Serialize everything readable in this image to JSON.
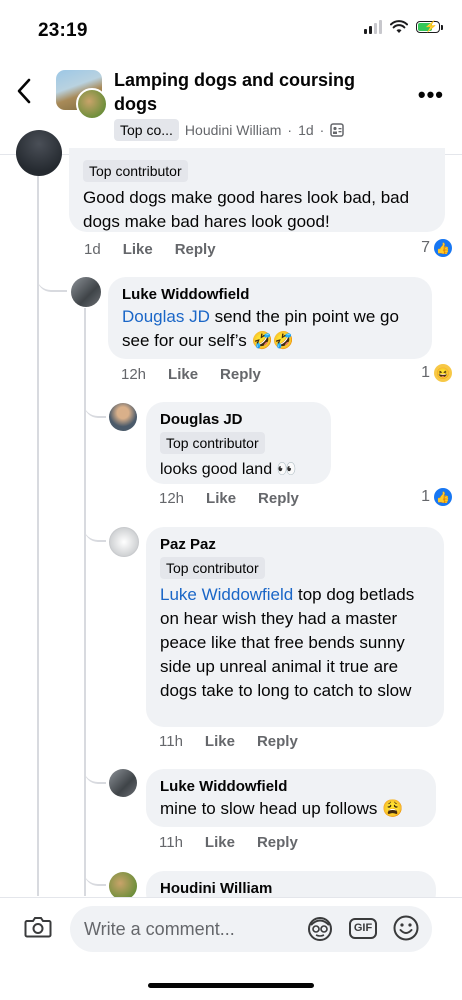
{
  "status_bar": {
    "time": "23:19",
    "battery_level": 0.7
  },
  "header": {
    "group_name": "Lamping dogs and coursing dogs",
    "badge": "Top co...",
    "author": "Houdini William",
    "age": "1d",
    "icons": [
      "back-chevron-icon",
      "more-options-icon",
      "group-privacy-icon"
    ]
  },
  "comments": [
    {
      "badge": "Top contributor",
      "text": "Good dogs make good hares look bad, bad dogs make bad hares look good!",
      "time": "1d",
      "like": "Like",
      "reply": "Reply",
      "reaction_count": "7",
      "reaction": "like"
    },
    {
      "name": "Luke Widdowfield",
      "mention": "Douglas JD",
      "text": " send the pin point we go see for our self’s 🤣🤣",
      "time": "12h",
      "like": "Like",
      "reply": "Reply",
      "reaction_count": "1",
      "reaction": "haha"
    },
    {
      "name": "Douglas JD",
      "badge": "Top contributor",
      "text": "looks good land 👀",
      "time": "12h",
      "like": "Like",
      "reply": "Reply",
      "reaction_count": "1",
      "reaction": "like"
    },
    {
      "name": "Paz Paz",
      "badge": "Top contributor",
      "mention": "Luke Widdowfield",
      "text": "  top dog betlads on hear wish they had a master peace like that free bends sunny side  up unreal animal  it true are dogs take to long to catch to slow",
      "time": "11h",
      "like": "Like",
      "reply": "Reply"
    },
    {
      "name": "Luke Widdowfield",
      "text": "mine to slow head up follows 😩",
      "time": "11h",
      "like": "Like",
      "reply": "Reply"
    },
    {
      "name": "Houdini William"
    }
  ],
  "composer": {
    "placeholder": "Write a comment...",
    "gif_label": "GIF",
    "icons": [
      "camera-icon",
      "avatar-sticker-icon",
      "gif-icon",
      "emoji-icon"
    ]
  },
  "colors": {
    "link": "#1a66c7",
    "like_blue": "#1877f2",
    "bubble": "#f0f2f5",
    "muted": "#65676b"
  }
}
